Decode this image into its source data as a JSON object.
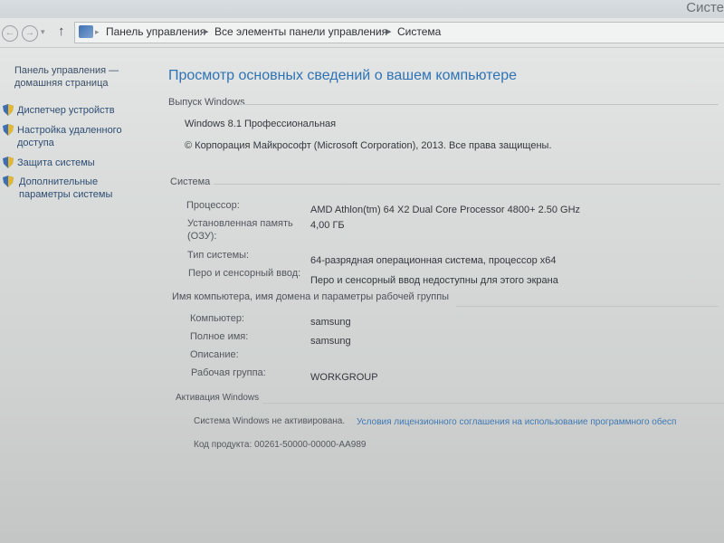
{
  "window": {
    "title": "Систе"
  },
  "address_bar": {
    "crumbs": [
      "Панель управления",
      "Все элементы панели управления",
      "Система"
    ],
    "separator": "▸"
  },
  "nav": {
    "back": "←",
    "forward": "→",
    "dropdown": "▾",
    "up": "↑"
  },
  "sidebar": {
    "home": "Панель управления — домашняя страница",
    "items": [
      {
        "label": "Диспетчер устройств",
        "icon": "shield-icon"
      },
      {
        "label": "Настройка удаленного доступа",
        "icon": "shield-icon"
      },
      {
        "label": "Защита системы",
        "icon": "shield-icon"
      },
      {
        "label": "Дополнительные параметры системы",
        "icon": "shield-icon"
      }
    ]
  },
  "main": {
    "title": "Просмотр основных сведений о вашем компьютере",
    "edition": {
      "header": "Выпуск Windows",
      "name": "Windows 8.1 Профессиональная",
      "copyright": "© Корпорация Майкрософт (Microsoft Corporation), 2013. Все права защищены."
    },
    "system": {
      "header": "Система",
      "rows": [
        {
          "label": "Процессор:",
          "value": "AMD Athlon(tm) 64 X2 Dual Core Processor 4800+   2.50 GHz"
        },
        {
          "label": "Установленная память (ОЗУ):",
          "value": "4,00 ГБ"
        },
        {
          "label": "Тип системы:",
          "value": "64-разрядная операционная система, процессор x64"
        },
        {
          "label": "Перо и сенсорный ввод:",
          "value": "Перо и сенсорный ввод недоступны для этого экрана"
        }
      ]
    },
    "computer": {
      "header": "Имя компьютера, имя домена и параметры рабочей группы",
      "rows": [
        {
          "label": "Компьютер:",
          "value": "samsung"
        },
        {
          "label": "Полное имя:",
          "value": "samsung"
        },
        {
          "label": "Описание:",
          "value": ""
        },
        {
          "label": "Рабочая группа:",
          "value": "WORKGROUP"
        }
      ]
    },
    "activation": {
      "header": "Активация Windows",
      "status": "Система Windows не активирована.",
      "license_link": "Условия лицензионного соглашения на использование программного обесп",
      "product_id": "Код продукта:  00261-50000-00000-AA989"
    }
  },
  "colors": {
    "accent": "#2f73b5",
    "link": "#3f78b4",
    "shield_blue": "#3f6fb0",
    "shield_yellow": "#e2b733"
  }
}
